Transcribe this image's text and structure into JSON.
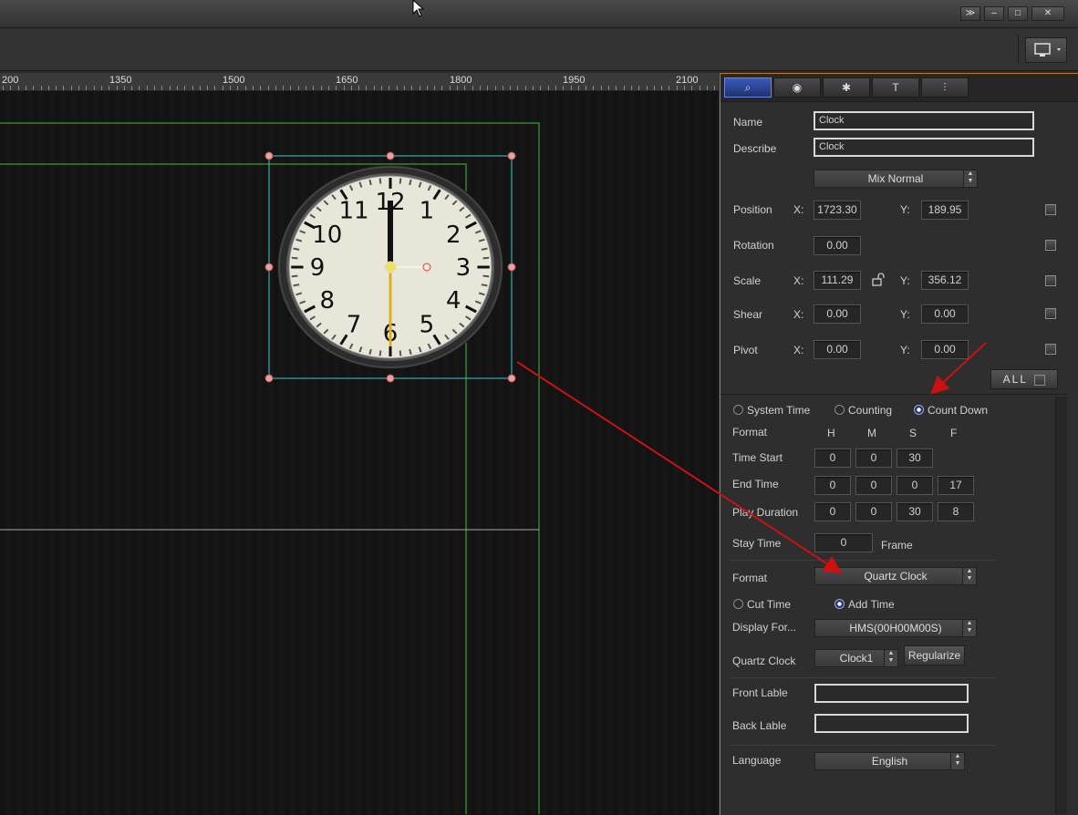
{
  "window": {
    "buttons": [
      "≫",
      "–",
      "□",
      "✕"
    ]
  },
  "toolbar": {
    "monitor_icon": "monitor-icon"
  },
  "ruler": {
    "labels": [
      "200",
      "1350",
      "1500",
      "1650",
      "1800",
      "1950",
      "2100"
    ]
  },
  "clock_face": {
    "numbers": [
      "12",
      "1",
      "2",
      "3",
      "4",
      "5",
      "6",
      "7",
      "8",
      "9",
      "10",
      "11"
    ]
  },
  "panel": {
    "tabs": [
      {
        "icon": "select-icon",
        "glyph": "⌕"
      },
      {
        "icon": "palette-icon",
        "glyph": "◉"
      },
      {
        "icon": "effects-icon",
        "glyph": "✱"
      },
      {
        "icon": "text-icon",
        "glyph": "T"
      },
      {
        "icon": "align-icon",
        "glyph": "⫶"
      }
    ],
    "name_label": "Name",
    "name_value": "Clock",
    "describe_label": "Describe",
    "describe_value": "Clock",
    "blend_mode": "Mix Normal",
    "position_label": "Position",
    "position_x": "1723.30",
    "position_y": "189.95",
    "rotation_label": "Rotation",
    "rotation_value": "0.00",
    "scale_label": "Scale",
    "scale_x": "111.29",
    "scale_y": "356.12",
    "shear_label": "Shear",
    "shear_x": "0.00",
    "shear_y": "0.00",
    "pivot_label": "Pivot",
    "pivot_x": "0.00",
    "pivot_y": "0.00",
    "x_label": "X:",
    "y_label": "Y:",
    "all_button": "ALL"
  },
  "timer": {
    "mode_system": "System Time",
    "mode_counting": "Counting",
    "mode_countdown": "Count Down",
    "selected_mode": "Count Down",
    "format_label": "Format",
    "col_h": "H",
    "col_m": "M",
    "col_s": "S",
    "col_f": "F",
    "time_start_label": "Time Start",
    "time_start": [
      "0",
      "0",
      "30"
    ],
    "end_time_label": "End Time",
    "end_time": [
      "0",
      "0",
      "0",
      "17"
    ],
    "play_duration_label": "Play Duration",
    "play_duration": [
      "0",
      "0",
      "30",
      "8"
    ],
    "stay_time_label": "Stay Time",
    "stay_time": "0",
    "frame_label": "Frame",
    "format2_label": "Format",
    "format_value": "Quartz Clock",
    "cut_time": "Cut Time",
    "add_time": "Add Time",
    "display_format_label": "Display For...",
    "display_format_value": "HMS(00H00M00S)",
    "quartz_clock_label": "Quartz Clock",
    "quartz_clock_value": "Clock1",
    "regularize_button": "Regularize",
    "front_label_label": "Front Lable",
    "front_label_value": "",
    "back_label_label": "Back Lable",
    "back_label_value": "",
    "language_label": "Language",
    "language_value": "English"
  },
  "colors": {
    "accent_orange": "#c07a20",
    "annotation_red": "#cc1111",
    "guide_green": "#3fbf3f",
    "selection_cyan": "#3cc8c8"
  }
}
